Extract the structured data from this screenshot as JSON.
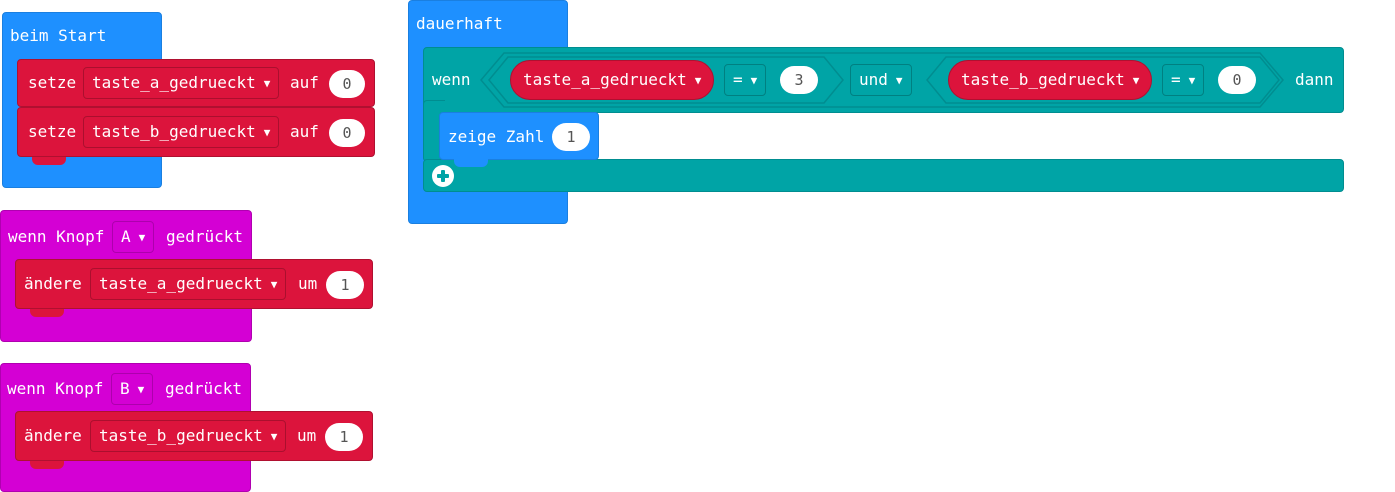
{
  "beim_start": {
    "title": "beim Start",
    "rows": [
      {
        "verb": "setze",
        "variable": "taste_a_gedrueckt",
        "word": "auf",
        "value": "0"
      },
      {
        "verb": "setze",
        "variable": "taste_b_gedrueckt",
        "word": "auf",
        "value": "0"
      }
    ]
  },
  "button_a": {
    "prefix": "wenn Knopf",
    "button": "A",
    "suffix": "gedrückt",
    "row": {
      "verb": "ändere",
      "variable": "taste_a_gedrueckt",
      "word": "um",
      "value": "1"
    }
  },
  "button_b": {
    "prefix": "wenn Knopf",
    "button": "B",
    "suffix": "gedrückt",
    "row": {
      "verb": "ändere",
      "variable": "taste_b_gedrueckt",
      "word": "um",
      "value": "1"
    }
  },
  "forever": {
    "title": "dauerhaft",
    "if": {
      "if_label": "wenn",
      "then_label": "dann",
      "left": {
        "variable": "taste_a_gedrueckt",
        "operator": "=",
        "value": "3"
      },
      "logic": "und",
      "right": {
        "variable": "taste_b_gedrueckt",
        "operator": "=",
        "value": "0"
      }
    },
    "show": {
      "label": "zeige Zahl",
      "value": "1"
    }
  },
  "icons": {
    "dropdown": "chevron-down-icon",
    "add": "plus-circle-icon"
  },
  "colors": {
    "events": "#1e90ff",
    "variables": "#dc143c",
    "input": "#d400d4",
    "logic": "#00a4a6",
    "basic": "#1e90ff"
  }
}
